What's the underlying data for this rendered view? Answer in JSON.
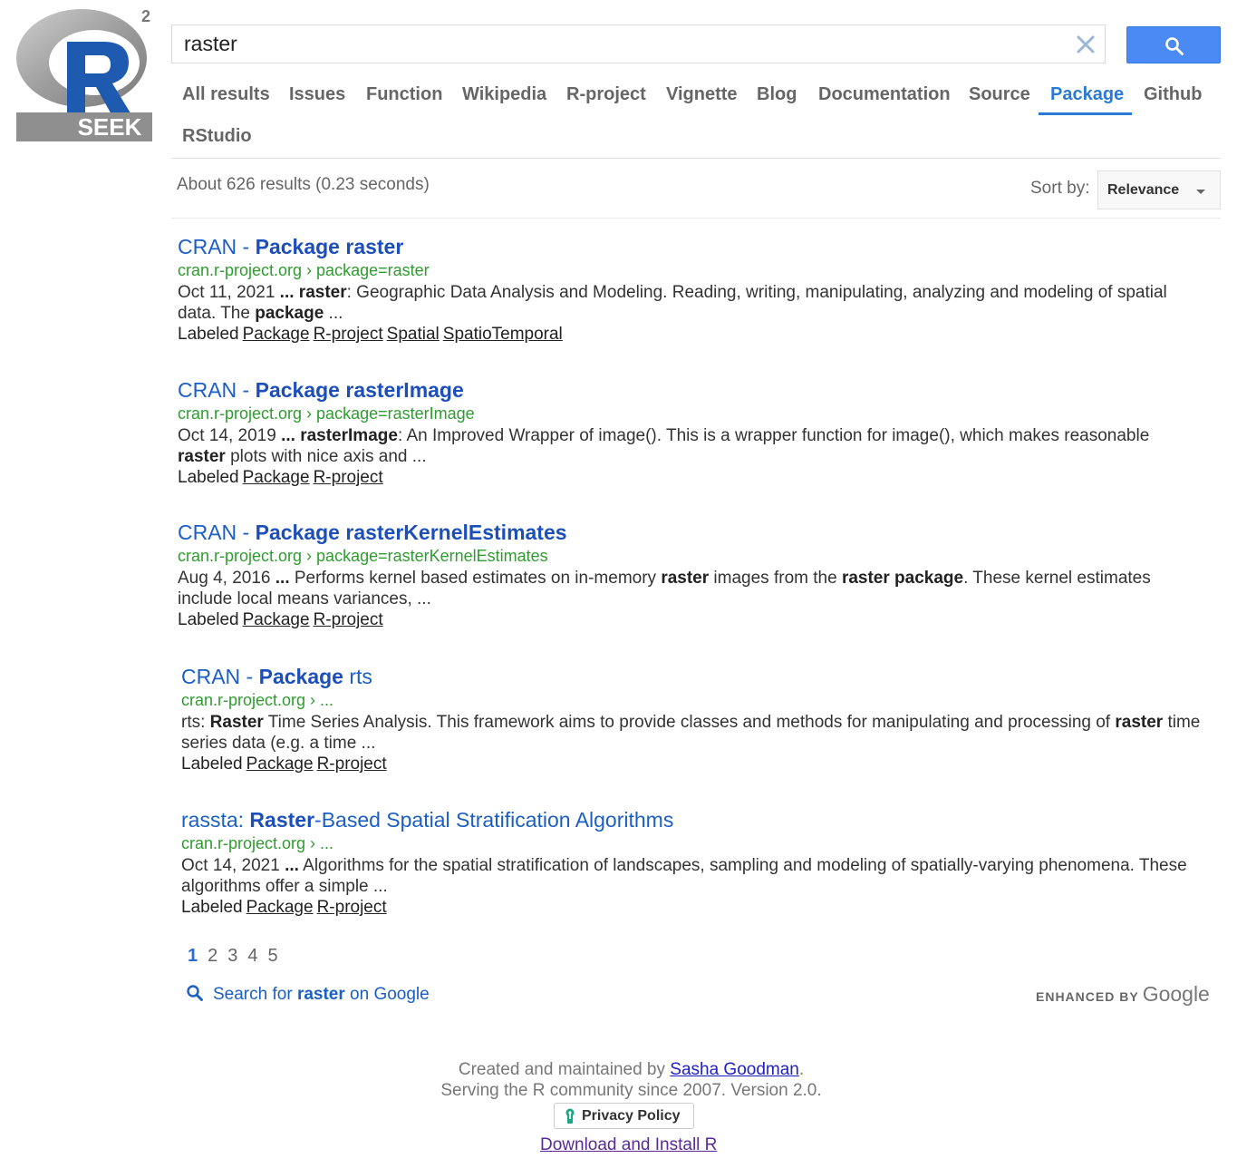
{
  "logo": {
    "letter": "R",
    "superscript": "2",
    "text": "SEEK"
  },
  "search": {
    "value": "raster",
    "clear_icon": "close-icon",
    "button_icon": "search-icon"
  },
  "tabs": [
    {
      "label": "All results"
    },
    {
      "label": "Issues"
    },
    {
      "label": "Function"
    },
    {
      "label": "Wikipedia"
    },
    {
      "label": "R-project"
    },
    {
      "label": "Vignette"
    },
    {
      "label": "Blog"
    },
    {
      "label": "Documentation"
    },
    {
      "label": "Source"
    },
    {
      "label": "Package",
      "active": true
    },
    {
      "label": "Github"
    },
    {
      "label": "RStudio"
    }
  ],
  "result_info": "About 626 results (0.23 seconds)",
  "sort": {
    "label": "Sort by:",
    "value": "Relevance"
  },
  "results": [
    {
      "title_plain": "CRAN - ",
      "title_bold": "Package raster",
      "title_rest": "",
      "url": "cran.r-project.org › package=raster",
      "snippet": [
        {
          "t": "Oct 11, 2021 "
        },
        {
          "t": "...",
          "b": true
        },
        {
          "t": " "
        },
        {
          "t": "raster",
          "b": true
        },
        {
          "t": ": Geographic Data Analysis and Modeling. Reading, writing, manipulating, analyzing and modeling of spatial data. The "
        },
        {
          "t": "package",
          "b": true
        },
        {
          "t": " ..."
        }
      ],
      "labels_prefix": "Labeled",
      "labels": [
        "Package",
        "R-project",
        "Spatial",
        "SpatioTemporal"
      ]
    },
    {
      "title_plain": "CRAN - ",
      "title_bold": "Package rasterImage",
      "title_rest": "",
      "url": "cran.r-project.org › package=rasterImage",
      "snippet": [
        {
          "t": "Oct 14, 2019 "
        },
        {
          "t": "...",
          "b": true
        },
        {
          "t": " "
        },
        {
          "t": "rasterImage",
          "b": true
        },
        {
          "t": ": An Improved Wrapper of image(). This is a wrapper function for image(), which makes reasonable "
        },
        {
          "t": "raster",
          "b": true
        },
        {
          "t": " plots with nice axis and ..."
        }
      ],
      "labels_prefix": "Labeled",
      "labels": [
        "Package",
        "R-project"
      ]
    },
    {
      "title_plain": "CRAN - ",
      "title_bold": "Package rasterKernelEstimates",
      "title_rest": "",
      "url": "cran.r-project.org › package=rasterKernelEstimates",
      "snippet": [
        {
          "t": "Aug 4, 2016 "
        },
        {
          "t": "...",
          "b": true
        },
        {
          "t": " Performs kernel based estimates on in-memory "
        },
        {
          "t": "raster",
          "b": true
        },
        {
          "t": " images from the "
        },
        {
          "t": "raster package",
          "b": true
        },
        {
          "t": ". These kernel estimates include local means variances, ..."
        }
      ],
      "labels_prefix": "Labeled",
      "labels": [
        "Package",
        "R-project"
      ]
    },
    {
      "title_plain": "CRAN - ",
      "title_bold": "Package",
      "title_rest": " rts",
      "url": "cran.r-project.org › ...",
      "snippet": [
        {
          "t": "rts: "
        },
        {
          "t": "Raster",
          "b": true
        },
        {
          "t": " Time Series Analysis. This framework aims to provide classes and methods for manipulating and processing of "
        },
        {
          "t": "raster",
          "b": true
        },
        {
          "t": " time series data (e.g. a time ..."
        }
      ],
      "labels_prefix": "Labeled",
      "labels": [
        "Package",
        "R-project"
      ]
    },
    {
      "title_plain": "rassta: ",
      "title_bold": "Raster",
      "title_rest": "-Based Spatial Stratification Algorithms",
      "url": "cran.r-project.org › ...",
      "snippet": [
        {
          "t": "Oct 14, 2021 "
        },
        {
          "t": "...",
          "b": true
        },
        {
          "t": " Algorithms for the spatial stratification of landscapes, sampling and modeling of spatially-varying phenomena. These algorithms offer a simple ..."
        }
      ],
      "labels_prefix": "Labeled",
      "labels": [
        "Package",
        "R-project"
      ]
    }
  ],
  "pagination": {
    "pages": [
      "1",
      "2",
      "3",
      "4",
      "5"
    ],
    "current": "1"
  },
  "google_search": {
    "prefix": "Search for ",
    "term": "raster",
    "suffix": " on Google"
  },
  "enhanced": {
    "prefix": "ENHANCED BY",
    "brand": "Google"
  },
  "footer": {
    "line1_prefix": "Created and maintained by ",
    "author": "Sasha Goodman",
    "line1_suffix": ".",
    "line2": "Serving the R community since 2007. Version 2.0.",
    "privacy": "Privacy Policy",
    "download": "Download and Install R"
  },
  "colors": {
    "accent": "#2a7ad5",
    "url_green": "#2f9c30",
    "search_button": "#4a8af4"
  }
}
